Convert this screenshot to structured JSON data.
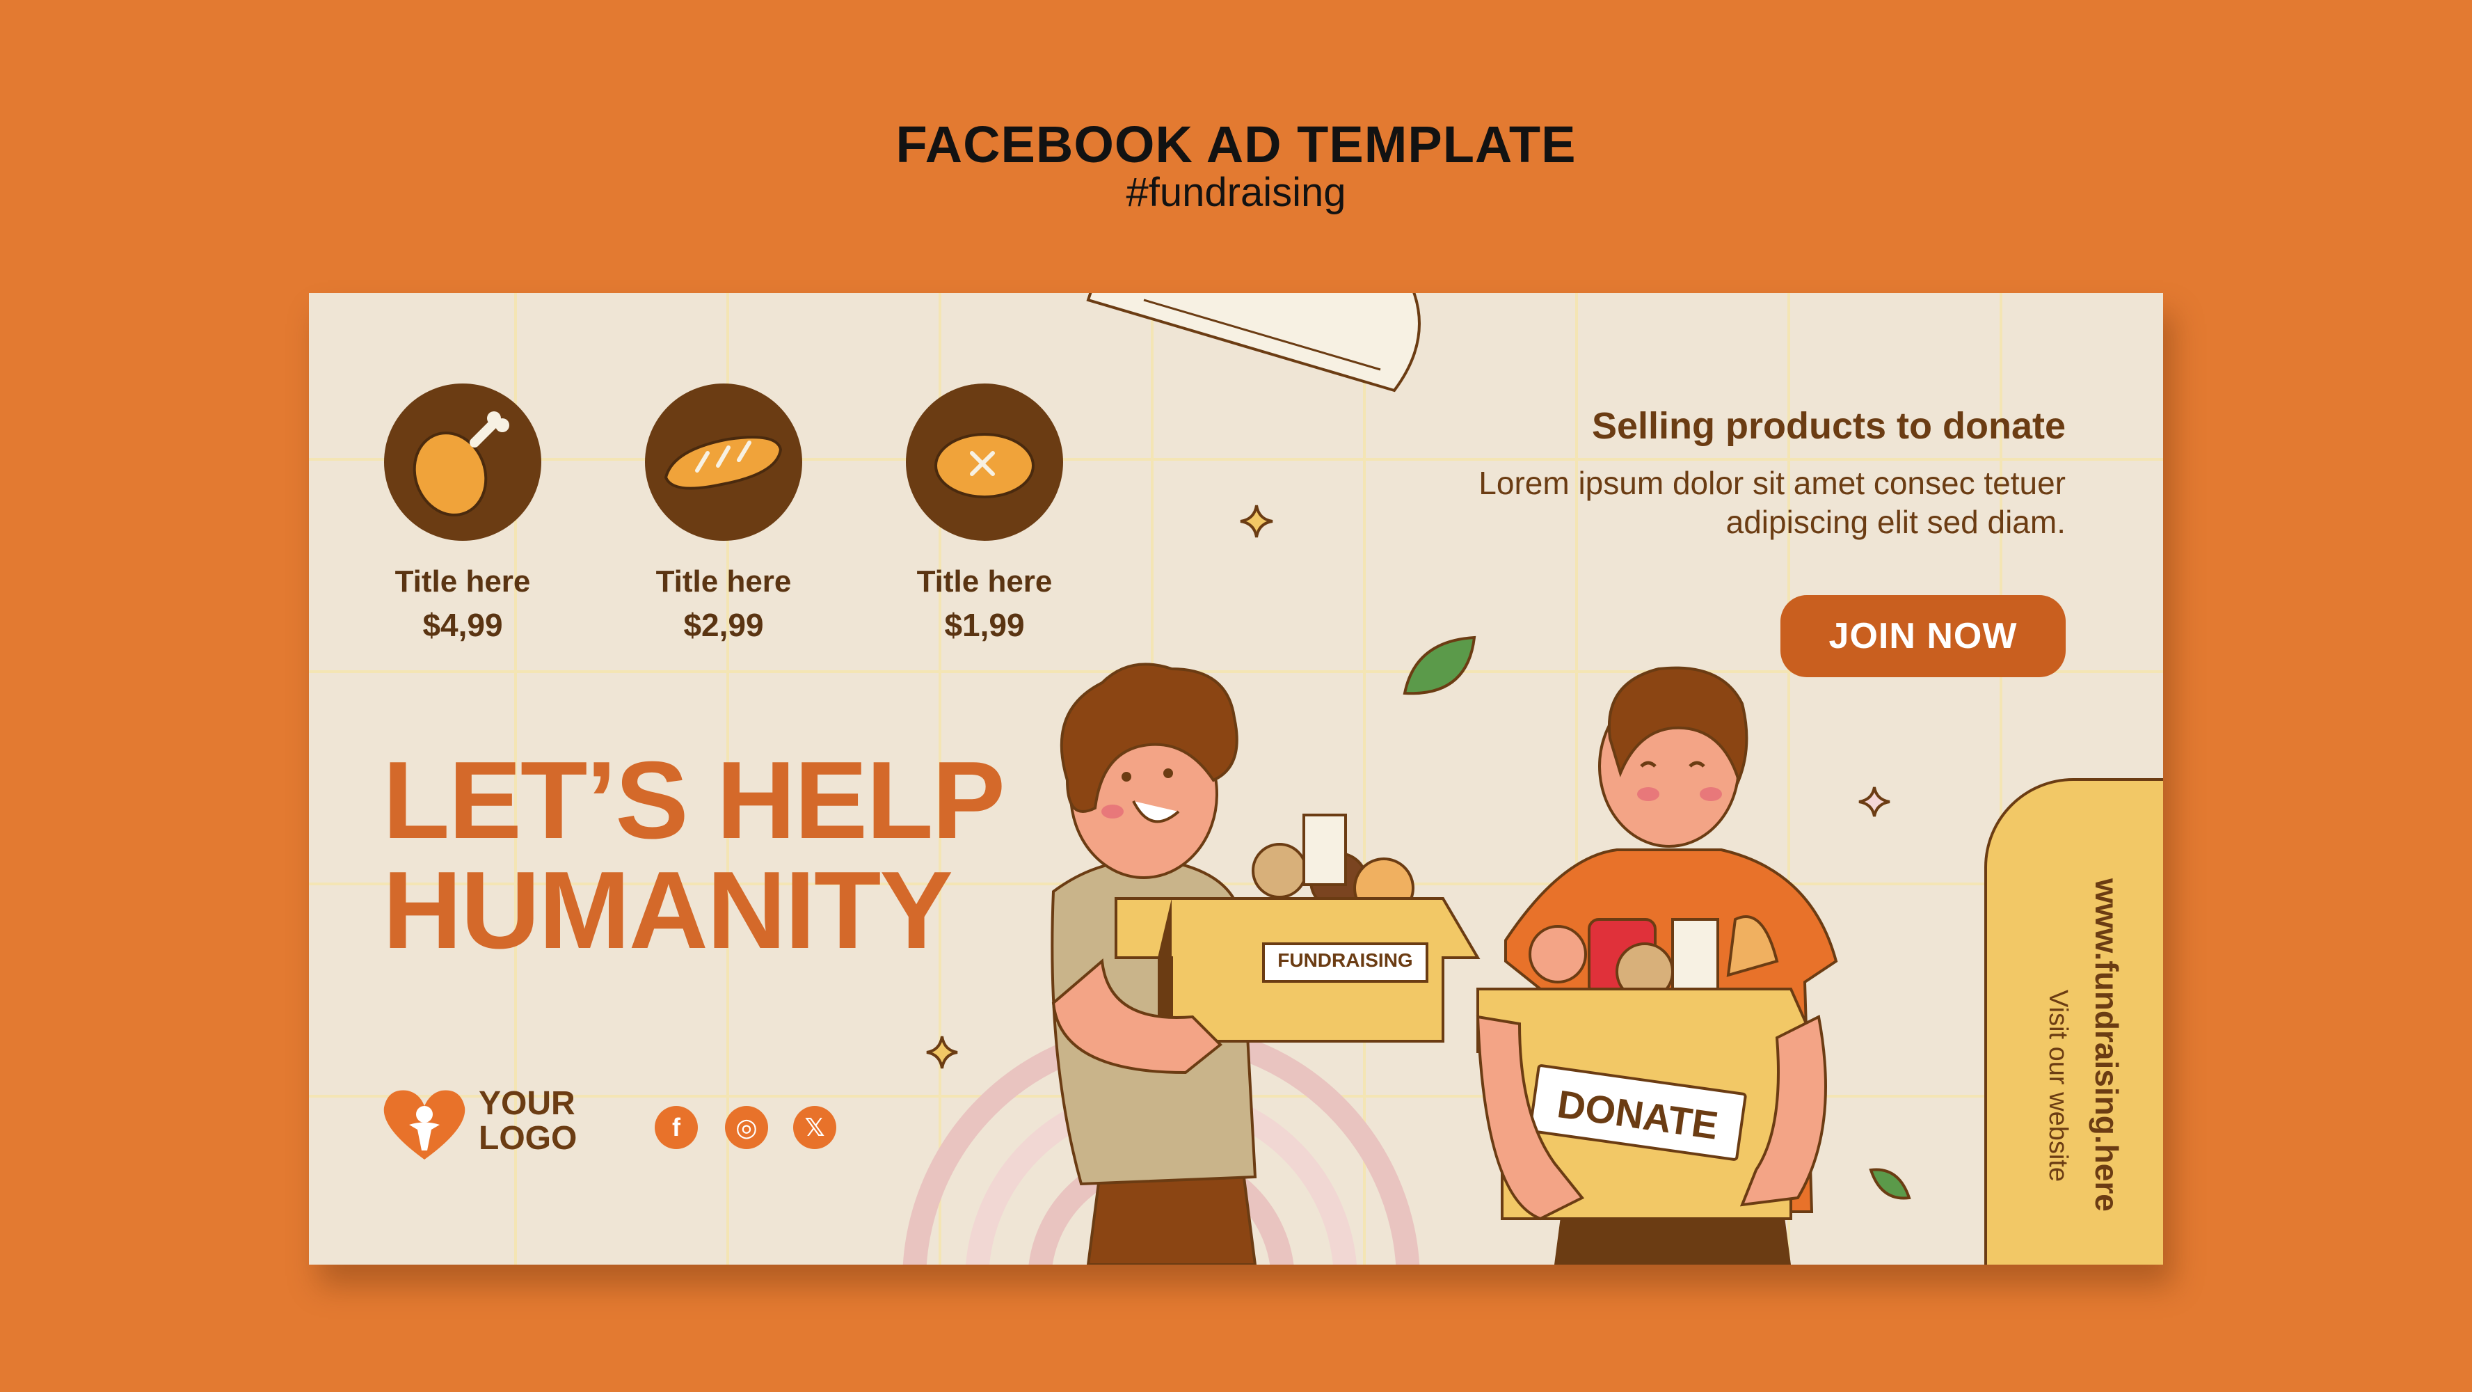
{
  "header": {
    "title": "FACEBOOK AD TEMPLATE",
    "subtitle": "#fundraising"
  },
  "products": [
    {
      "title": "Title here",
      "price": "$4,99",
      "icon": "chicken-leg-icon"
    },
    {
      "title": "Title here",
      "price": "$2,99",
      "icon": "baguette-icon"
    },
    {
      "title": "Title here",
      "price": "$1,99",
      "icon": "bread-loaf-icon"
    }
  ],
  "headline": {
    "line1": "LET’S HELP",
    "line2": "HUMANITY"
  },
  "logo": {
    "line1": "YOUR",
    "line2": "LOGO"
  },
  "social": {
    "facebook": "f",
    "instagram": "◎",
    "x": "𝕏"
  },
  "promo": {
    "title": "Selling products to donate",
    "text": "Lorem ipsum dolor sit amet consec tetuer adipiscing elit sed diam.",
    "cta": "JOIN NOW"
  },
  "website": {
    "url": "www.fundraising.here",
    "label": "Visit our website"
  },
  "boxes": {
    "left": "FUNDRAISING",
    "right": "DONATE"
  },
  "colors": {
    "background": "#e37a31",
    "banner": "#efe5d5",
    "accent": "#d4692a",
    "brown": "#6b3c13",
    "yellow": "#f2c866"
  }
}
